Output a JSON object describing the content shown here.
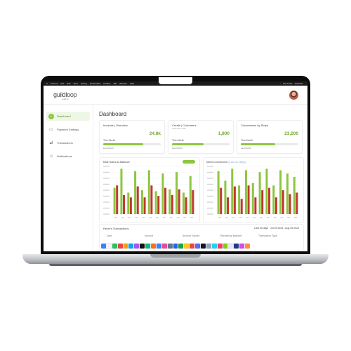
{
  "menubar": {
    "items": [
      "Chrome",
      "File",
      "Edit",
      "View",
      "History",
      "Bookmarks",
      "Profiles",
      "Tab",
      "Window",
      "Help"
    ],
    "right": [
      "",
      "Thu 5 Dec",
      "5:00 PM"
    ]
  },
  "app": {
    "logo": "guildloop",
    "logo_tagline": "guildloop"
  },
  "sidebar": {
    "items": [
      {
        "label": "Dashboard",
        "icon": "home-icon",
        "active": true
      },
      {
        "label": "Payment Settings",
        "icon": "card-icon",
        "active": false
      },
      {
        "label": "Transactions",
        "icon": "exchange-icon",
        "active": false
      },
      {
        "label": "Notifications",
        "icon": "bell-icon",
        "active": false
      }
    ]
  },
  "main": {
    "title": "Dashboard",
    "cards": [
      {
        "title": "Invoices | Overview",
        "subtitle": "",
        "value": "24.8k",
        "label": "This Month",
        "progress": 0.7,
        "footer": "Last Month"
      },
      {
        "title": "Create | Customers",
        "subtitle": "Overview chart",
        "value": "1,800",
        "label": "This Month",
        "progress": 0.55,
        "footer": "Last Month"
      },
      {
        "title": "Conversions by Stripe",
        "subtitle": "",
        "value": "23,200",
        "label": "This Month",
        "progress": 0.6,
        "footer": "Last Month"
      }
    ],
    "charts": [
      {
        "title": "Total Sales & Balance",
        "link": ""
      },
      {
        "title": "Ideal Conversion",
        "link": "(Last 30 days)"
      }
    ],
    "transactions": {
      "title": "Recent Transactions",
      "range": "Last 30 days · Jul 25 2024 - Aug 25 2024",
      "columns": [
        "Date",
        "Amount",
        "Amount Earned",
        "Remaining Balance",
        "Transaction Type"
      ]
    }
  },
  "dock": {
    "colors": [
      "#3b82f6",
      "#f4f4f4",
      "#22c55e",
      "#ef4444",
      "#f59e0b",
      "#0ea5e9",
      "#a855f7",
      "#111111",
      "#10b981",
      "#f97316",
      "#3b82f6",
      "#ec4899",
      "#64748b",
      "#2563eb",
      "#16a34a",
      "#facc15",
      "#ef4444",
      "#6366f1",
      "#0f172a",
      "#94a3b8",
      "#22d3ee",
      "#f43f5e",
      "#84cc16",
      "#e5e7eb",
      "#1e3a8a",
      "#d946ef",
      "#fb923c"
    ]
  },
  "chart_data": [
    {
      "type": "bar",
      "title": "Total Sales & Balance",
      "categories": [
        "1",
        "2",
        "3",
        "4",
        "5",
        "6",
        "7",
        "8",
        "9",
        "10",
        "11",
        "12"
      ],
      "series": [
        {
          "values": [
            55,
            95,
            45,
            90,
            50,
            92,
            48,
            85,
            52,
            88,
            45,
            80
          ],
          "color": "#8dc63f"
        },
        {
          "values": [
            60,
            40,
            35,
            58,
            35,
            60,
            38,
            55,
            40,
            52,
            35,
            50
          ],
          "color": "#c0392b"
        }
      ],
      "ylim": [
        0,
        100
      ]
    },
    {
      "type": "bar",
      "title": "Ideal Conversion",
      "categories": [
        "1",
        "2",
        "3",
        "4",
        "5",
        "6",
        "7",
        "8",
        "9",
        "10",
        "11",
        "12"
      ],
      "series": [
        {
          "values": [
            90,
            70,
            95,
            60,
            92,
            65,
            88,
            95,
            60,
            92,
            85,
            78
          ],
          "color": "#8dc63f"
        },
        {
          "values": [
            55,
            35,
            58,
            32,
            60,
            35,
            50,
            55,
            35,
            50,
            42,
            45
          ],
          "color": "#c0392b"
        }
      ],
      "ylim": [
        0,
        100
      ]
    }
  ]
}
